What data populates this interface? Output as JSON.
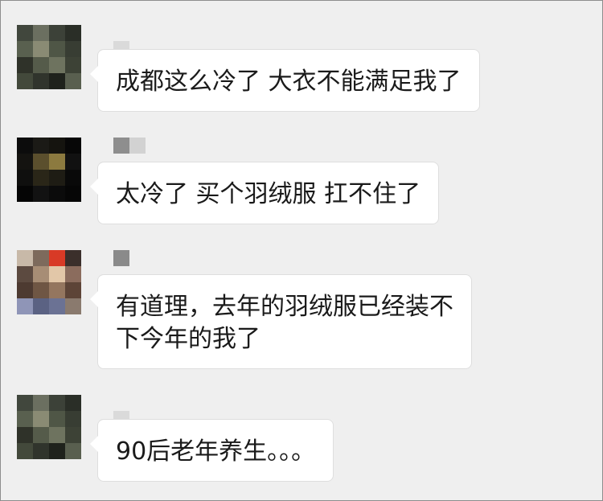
{
  "chat": {
    "messages": [
      {
        "avatar": "blurred-avatar",
        "nickname": "",
        "lines": [
          "成都这么冷了 大衣不能满足我了"
        ]
      },
      {
        "avatar": "blurred-avatar",
        "nickname": "",
        "lines": [
          "太冷了 买个羽绒服 扛不住了"
        ]
      },
      {
        "avatar": "blurred-avatar",
        "nickname": "",
        "lines": [
          "有道理，去年的羽绒服已经装不",
          "下今年的我了"
        ]
      },
      {
        "avatar": "blurred-avatar",
        "nickname": "",
        "lines": [
          "90后老年养生。。。"
        ]
      }
    ]
  },
  "colors": {
    "background": "#efefef",
    "bubble": "#ffffff",
    "text": "#1a1a1a"
  }
}
